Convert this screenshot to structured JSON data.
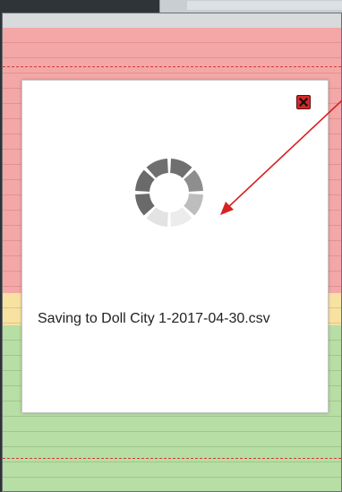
{
  "modal": {
    "status_text": "Saving to Doll City 1-2017-04-30.csv",
    "close_icon": "close-icon",
    "spinner_icon": "loading-spinner-icon"
  },
  "background": {
    "band_colors": {
      "red": "#f4a7a7",
      "yellow": "#f7e2a2",
      "green": "#b7dea4"
    }
  },
  "annotation": {
    "arrow_color": "#d62222"
  },
  "colors": {
    "close_button": "#d92626",
    "spinner_dark": "#6f6f6f",
    "spinner_light": "#ececec"
  }
}
